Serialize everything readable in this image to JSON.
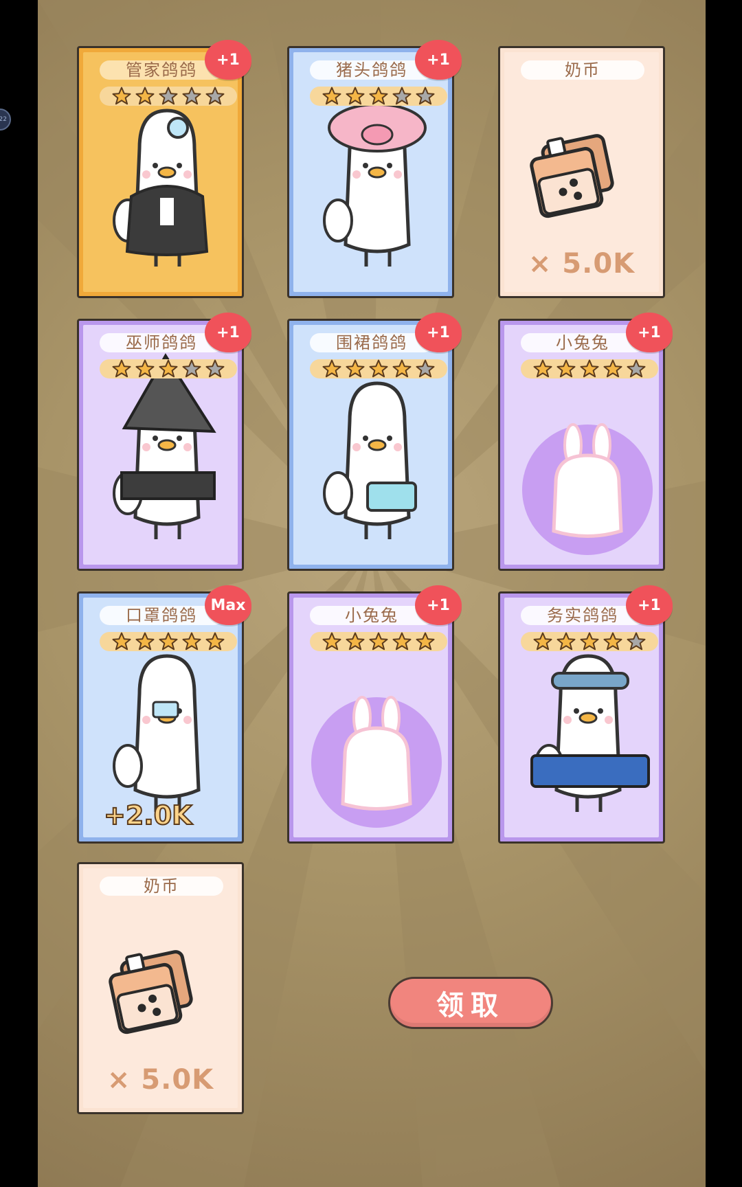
{
  "cards": [
    {
      "name": "管家鸽鸽",
      "rarity": "gold",
      "stars": 2,
      "max_stars": 5,
      "badge": "+1"
    },
    {
      "name": "猪头鸽鸽",
      "rarity": "blue",
      "stars": 3,
      "max_stars": 5,
      "badge": "+1"
    },
    {
      "name": "奶币",
      "rarity": "coin",
      "amount": "× 5.0K"
    },
    {
      "name": "巫师鸽鸽",
      "rarity": "purple",
      "stars": 3,
      "max_stars": 5,
      "badge": "+1"
    },
    {
      "name": "围裙鸽鸽",
      "rarity": "blue",
      "stars": 4,
      "max_stars": 5,
      "badge": "+1"
    },
    {
      "name": "小兔兔",
      "rarity": "purple",
      "stars": 4,
      "max_stars": 5,
      "badge": "+1"
    },
    {
      "name": "口罩鸽鸽",
      "rarity": "blue",
      "stars": 5,
      "max_stars": 5,
      "badge": "Max",
      "bonus": "+2.0K"
    },
    {
      "name": "小兔兔",
      "rarity": "purple",
      "stars": 5,
      "max_stars": 5,
      "badge": "+1"
    },
    {
      "name": "务实鸽鸽",
      "rarity": "purple",
      "stars": 4,
      "max_stars": 5,
      "badge": "+1"
    },
    {
      "name": "奶币",
      "rarity": "coin",
      "amount": "× 5.0K"
    }
  ],
  "claim_label": "领取",
  "side_indicator": "22",
  "icons": {
    "badge": "puzzle-piece-icon",
    "star": "star-icon",
    "coin": "milk-tea-coin-icon"
  },
  "colors": {
    "badge": "#f0525a",
    "claim": "#f1857e",
    "star_on": "#f4b646",
    "star_off": "#a8a8a8"
  }
}
